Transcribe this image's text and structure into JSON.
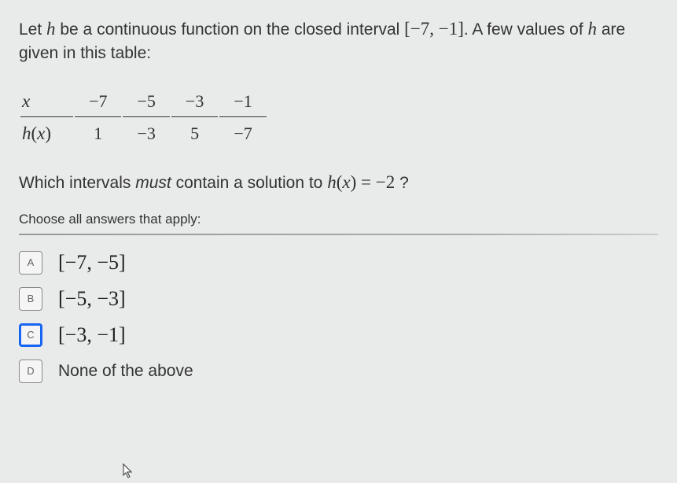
{
  "question": {
    "intro_part1": "Let ",
    "func_var": "h",
    "intro_part2": " be a continuous function on the closed interval ",
    "interval": "[−7, −1]",
    "intro_part3": ". A few values of ",
    "intro_part4": " are given in this table:"
  },
  "table": {
    "row1_label": "x",
    "row1_vals": [
      "−7",
      "−5",
      "−3",
      "−1"
    ],
    "row2_label": "h(x)",
    "row2_vals": [
      "1",
      "−3",
      "5",
      "−7"
    ]
  },
  "followup": {
    "part1": "Which intervals ",
    "emph": "must",
    "part2": " contain a solution to ",
    "equation_lhs": "h(x)",
    "equation_eq": " = ",
    "equation_rhs": "−2",
    "qmark": " ?"
  },
  "choose_label": "Choose all answers that apply:",
  "options": [
    {
      "letter": "A",
      "text": "[−7, −5]",
      "selected": false,
      "is_math": true
    },
    {
      "letter": "B",
      "text": "[−5, −3]",
      "selected": false,
      "is_math": true
    },
    {
      "letter": "C",
      "text": "[−3, −1]",
      "selected": true,
      "is_math": true
    },
    {
      "letter": "D",
      "text": "None of the above",
      "selected": false,
      "is_math": false
    }
  ]
}
